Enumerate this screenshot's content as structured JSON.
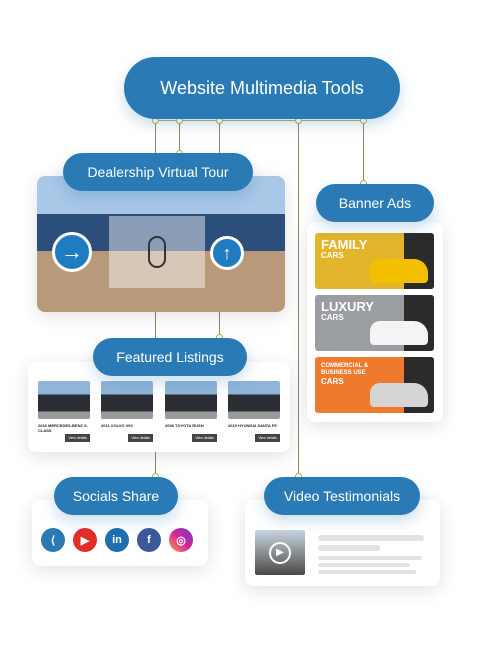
{
  "title": "Website Multimedia Tools",
  "virtual_tour": {
    "label": "Dealership Virtual Tour"
  },
  "banner_ads": {
    "label": "Banner Ads",
    "ads": [
      {
        "headline": "FAMILY",
        "sub": "CARS",
        "color": "#e2b52a"
      },
      {
        "headline": "LUXURY",
        "sub": "CARS",
        "color": "#9a9ea3"
      },
      {
        "headline": "COMMERCIAL & BUSINESS USE",
        "sub": "CARS",
        "color": "#ee7a2e"
      }
    ]
  },
  "featured": {
    "label": "Featured Listings",
    "items": [
      {
        "title": "2016 MERCEDES-BENZ S-CLASS",
        "button": "View details"
      },
      {
        "title": "2011 VOLVO V60",
        "button": "View details"
      },
      {
        "title": "2006 TOYOTA RUSH",
        "button": "View details"
      },
      {
        "title": "2015 HYUNDAI SANTA FE",
        "button": "View details"
      }
    ]
  },
  "socials": {
    "label": "Socials Share",
    "icons": [
      "share-icon",
      "youtube-icon",
      "linkedin-icon",
      "facebook-icon",
      "instagram-icon"
    ]
  },
  "video": {
    "label": "Video Testimonials"
  },
  "colors": {
    "accent": "#2a7bb5",
    "connector": "#c9a646"
  }
}
